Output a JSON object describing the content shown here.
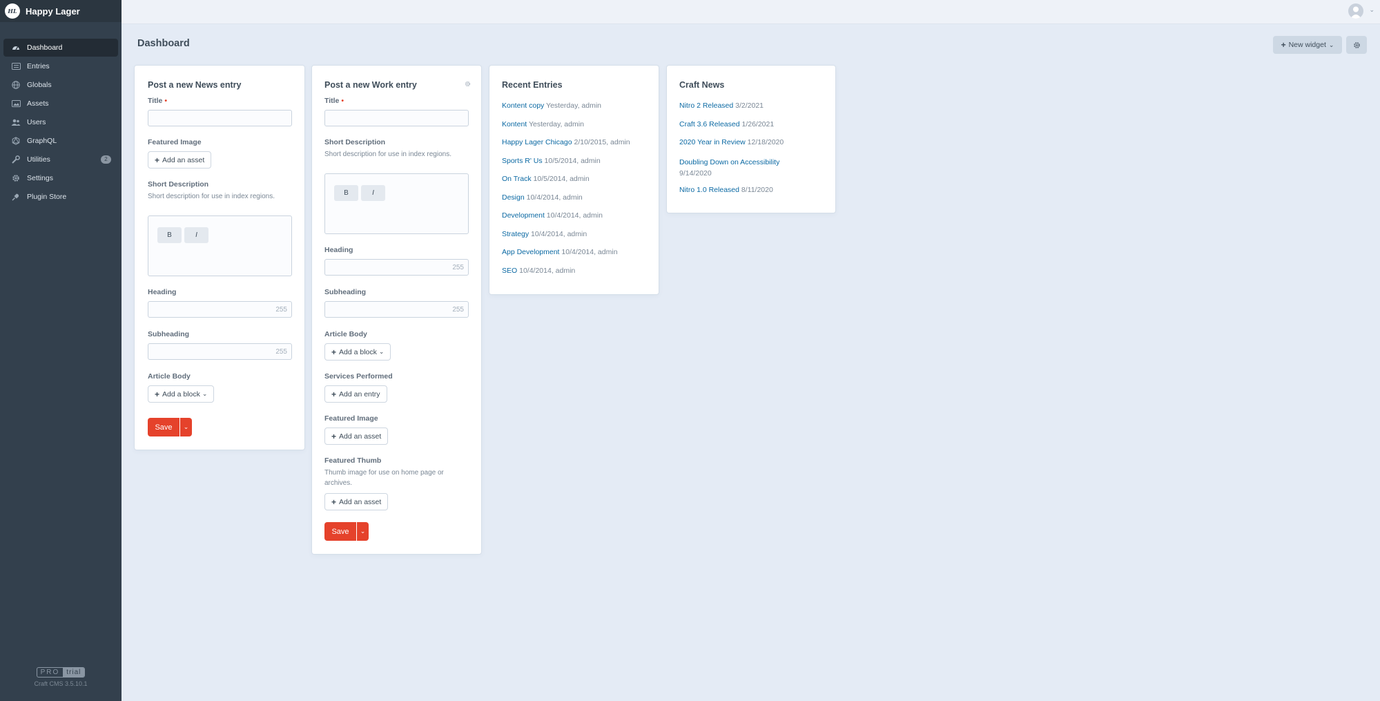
{
  "site": {
    "logo_text": "HL",
    "name": "Happy Lager"
  },
  "nav": [
    {
      "label": "Dashboard",
      "icon": "dashboard-icon",
      "active": true
    },
    {
      "label": "Entries",
      "icon": "entries-icon"
    },
    {
      "label": "Globals",
      "icon": "globe-icon"
    },
    {
      "label": "Assets",
      "icon": "image-icon"
    },
    {
      "label": "Users",
      "icon": "users-icon"
    },
    {
      "label": "GraphQL",
      "icon": "graphql-icon"
    },
    {
      "label": "Utilities",
      "icon": "wrench-icon",
      "badge": "2"
    },
    {
      "label": "Settings",
      "icon": "gear-icon"
    },
    {
      "label": "Plugin Store",
      "icon": "plug-icon"
    }
  ],
  "edition": {
    "name": "PRO",
    "status": "trial",
    "version": "Craft CMS 3.5.10.1"
  },
  "page": {
    "title": "Dashboard"
  },
  "toolbar": {
    "new_widget": "New widget"
  },
  "news_widget": {
    "title": "Post a new News entry",
    "title_label": "Title",
    "featured_image_label": "Featured Image",
    "add_asset": "Add an asset",
    "short_desc_label": "Short Description",
    "short_desc_instr": "Short description for use in index regions.",
    "bold": "B",
    "italic": "I",
    "heading_label": "Heading",
    "heading_count": "255",
    "subheading_label": "Subheading",
    "subheading_count": "255",
    "article_body_label": "Article Body",
    "add_block": "Add a block",
    "save": "Save"
  },
  "work_widget": {
    "title": "Post a new Work entry",
    "title_label": "Title",
    "short_desc_label": "Short Description",
    "short_desc_instr": "Short description for use in index regions.",
    "bold": "B",
    "italic": "I",
    "heading_label": "Heading",
    "heading_count": "255",
    "subheading_label": "Subheading",
    "subheading_count": "255",
    "article_body_label": "Article Body",
    "add_block": "Add a block",
    "services_label": "Services Performed",
    "add_entry": "Add an entry",
    "featured_image_label": "Featured Image",
    "add_asset": "Add an asset",
    "featured_thumb_label": "Featured Thumb",
    "featured_thumb_instr": "Thumb image for use on home page or archives.",
    "add_asset_2": "Add an asset",
    "save": "Save"
  },
  "recent_entries": {
    "title": "Recent Entries",
    "items": [
      {
        "title": "Kontent copy",
        "meta": "Yesterday, admin"
      },
      {
        "title": "Kontent",
        "meta": "Yesterday, admin"
      },
      {
        "title": "Happy Lager Chicago",
        "meta": "2/10/2015, admin"
      },
      {
        "title": "Sports R' Us",
        "meta": "10/5/2014, admin"
      },
      {
        "title": "On Track",
        "meta": "10/5/2014, admin"
      },
      {
        "title": "Design",
        "meta": "10/4/2014, admin"
      },
      {
        "title": "Development",
        "meta": "10/4/2014, admin"
      },
      {
        "title": "Strategy",
        "meta": "10/4/2014, admin"
      },
      {
        "title": "App Development",
        "meta": "10/4/2014, admin"
      },
      {
        "title": "SEO",
        "meta": "10/4/2014, admin"
      }
    ]
  },
  "craft_news": {
    "title": "Craft News",
    "items": [
      {
        "title": "Nitro 2 Released",
        "date": "3/2/2021"
      },
      {
        "title": "Craft 3.6 Released",
        "date": "1/26/2021"
      },
      {
        "title": "2020 Year in Review",
        "date": "12/18/2020"
      },
      {
        "title": "Doubling Down on Accessibility",
        "date": "9/14/2020"
      },
      {
        "title": "Nitro 1.0 Released",
        "date": "8/11/2020"
      }
    ]
  },
  "colors": {
    "sidebar": "#33404d",
    "accent": "#e5422b",
    "link": "#0b69a3",
    "background": "#e4ebf5"
  }
}
